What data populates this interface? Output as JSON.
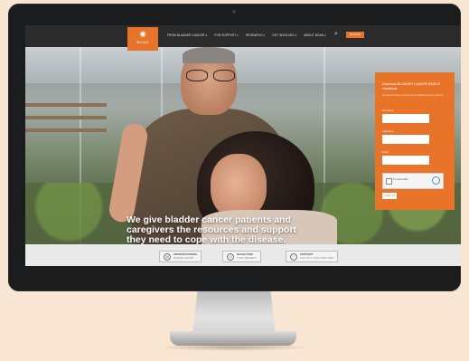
{
  "nav": {
    "logo_text": "BCAN",
    "menu": [
      "FROM BLADDER CANCER ▾",
      "FOR SUPPORT ▾",
      "RESEARCH ▾",
      "GET INVOLVED ▾",
      "ABOUT BCAN ▾"
    ],
    "search_icon": "search-icon",
    "donate_label": "DONATE"
  },
  "hero": {
    "headline": "We give bladder cancer patients and caregivers the resources and support they need to cope with the disease."
  },
  "signup": {
    "title": "Download BLADDER CANCER BASICS Handbook",
    "description": "Get the free basic resource for the bladder cancer patients",
    "first_name_label": "First Name",
    "last_name_label": "Last Name",
    "email_label": "Email",
    "captcha_label": "I'm not a robot",
    "submit_label": "SIGN UP"
  },
  "bottom_bar": {
    "items": [
      {
        "icon": "clipboard-icon",
        "title": "UNDERSTANDING",
        "subtitle": "BLADDER CANCER"
      },
      {
        "icon": "compass-icon",
        "title": "NAVIGATING",
        "subtitle": "YOUR TREATMENT"
      },
      {
        "icon": "heart-icon",
        "title": "SUPPORT",
        "subtitle": "FOR YOU & YOUR LOVED ONES"
      }
    ]
  },
  "colors": {
    "accent": "#e8742a",
    "nav_bg": "#2b2b2b",
    "page_bg": "#f8e5d2"
  }
}
